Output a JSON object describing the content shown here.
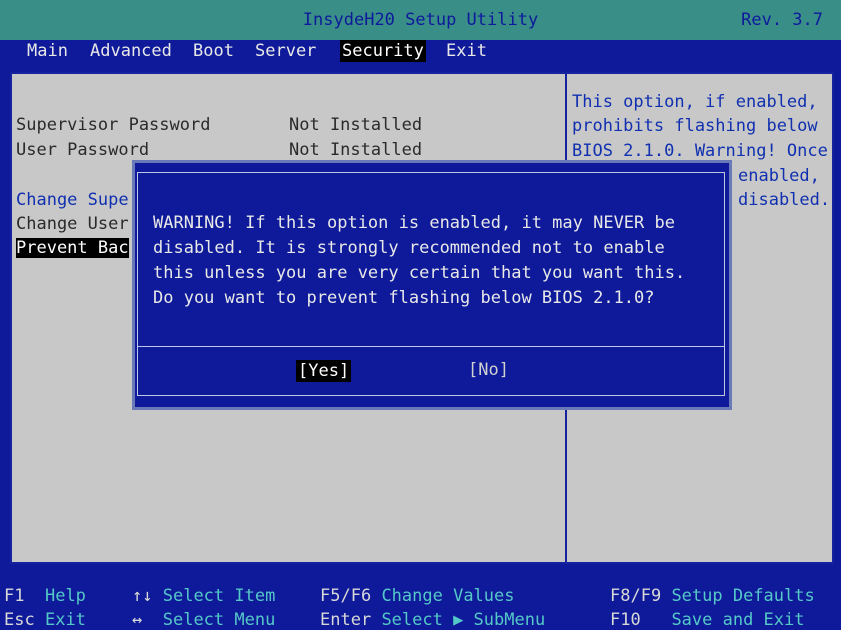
{
  "title": "InsydeH20 Setup Utility",
  "revision": "Rev. 3.7",
  "menu": [
    "Main",
    "Advanced",
    "Boot",
    "Server",
    "Security",
    "Exit"
  ],
  "menu_active": "Security",
  "items": {
    "supervisor_label": "Supervisor Password",
    "supervisor_value": "Not Installed",
    "user_label": "User Password",
    "user_value": "Not Installed",
    "change_supervisor": "Change Supe",
    "change_user": "Change User",
    "prevent_back": "Prevent Bac"
  },
  "help": [
    "This option, if enabled,",
    "prohibits flashing below",
    "BIOS 2.1.0. Warning! Once",
    "enabled,",
    "disabled."
  ],
  "dialog": {
    "lines": [
      "WARNING! If this option is enabled, it may NEVER be",
      "disabled. It is strongly recommended not to enable",
      "this unless you are very certain that you want this.",
      "Do you want to prevent flashing below BIOS 2.1.0?"
    ],
    "yes": "[Yes]",
    "no": "[No]"
  },
  "footer": {
    "f1_key": "F1",
    "f1_text": "Help",
    "esc_key": "Esc",
    "esc_text": "Exit",
    "updown_key": "↑↓",
    "updown_text": "Select Item",
    "leftright_key": "↔",
    "leftright_text": "Select Menu",
    "f5f6_key": "F5/F6",
    "f5f6_text": "Change Values",
    "enter_key": "Enter",
    "enter_text": "Select ▶ SubMenu",
    "f8f9_key": "F8/F9",
    "f8f9_text": "Setup Defaults",
    "f10_key": "F10",
    "f10_text": "Save and Exit"
  }
}
